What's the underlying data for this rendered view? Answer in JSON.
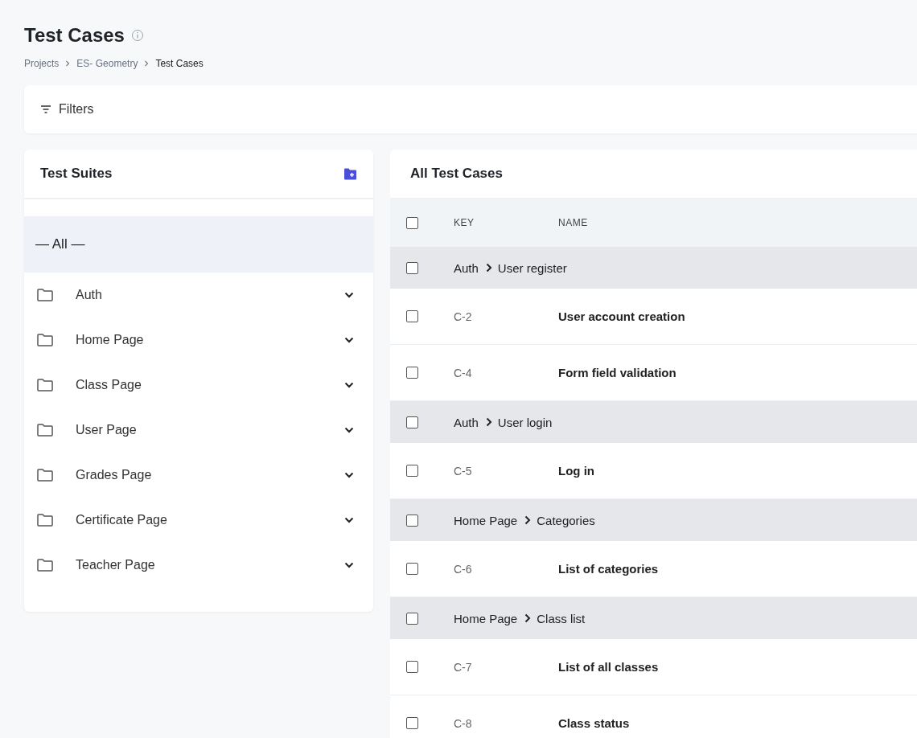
{
  "page": {
    "title": "Test Cases",
    "breadcrumb": [
      {
        "label": "Projects",
        "current": false
      },
      {
        "label": "ES- Geometry",
        "current": false
      },
      {
        "label": "Test Cases",
        "current": true
      }
    ]
  },
  "filters": {
    "label": "Filters"
  },
  "sidebar": {
    "title": "Test Suites",
    "items": [
      {
        "label": "— All —",
        "kind": "all",
        "selected": true
      },
      {
        "label": "Auth",
        "kind": "folder",
        "selected": false,
        "expanded": false
      },
      {
        "label": "Home Page",
        "kind": "folder",
        "selected": false,
        "expanded": false
      },
      {
        "label": "Class Page",
        "kind": "folder",
        "selected": false,
        "expanded": false
      },
      {
        "label": "User Page",
        "kind": "folder",
        "selected": false,
        "expanded": false
      },
      {
        "label": "Grades Page",
        "kind": "folder",
        "selected": false,
        "expanded": false
      },
      {
        "label": "Certificate Page",
        "kind": "folder",
        "selected": false,
        "expanded": false
      },
      {
        "label": "Teacher Page",
        "kind": "folder",
        "selected": false,
        "expanded": false
      }
    ]
  },
  "table": {
    "title": "All Test Cases",
    "header_checked": false,
    "columns": [
      "KEY",
      "NAME"
    ],
    "rows": [
      {
        "kind": "group",
        "checked": false,
        "suite": "Auth",
        "section": "User register"
      },
      {
        "kind": "case",
        "checked": false,
        "key": "C-2",
        "name": "User account creation"
      },
      {
        "kind": "case",
        "checked": false,
        "key": "C-4",
        "name": "Form field validation"
      },
      {
        "kind": "group",
        "checked": false,
        "suite": "Auth",
        "section": "User login"
      },
      {
        "kind": "case",
        "checked": false,
        "key": "C-5",
        "name": "Log in"
      },
      {
        "kind": "group",
        "checked": false,
        "suite": "Home Page",
        "section": "Categories"
      },
      {
        "kind": "case",
        "checked": false,
        "key": "C-6",
        "name": "List of categories"
      },
      {
        "kind": "group",
        "checked": false,
        "suite": "Home Page",
        "section": "Class list"
      },
      {
        "kind": "case",
        "checked": false,
        "key": "C-7",
        "name": "List of all classes"
      },
      {
        "kind": "case",
        "checked": false,
        "key": "C-8",
        "name": "Class status"
      }
    ]
  }
}
